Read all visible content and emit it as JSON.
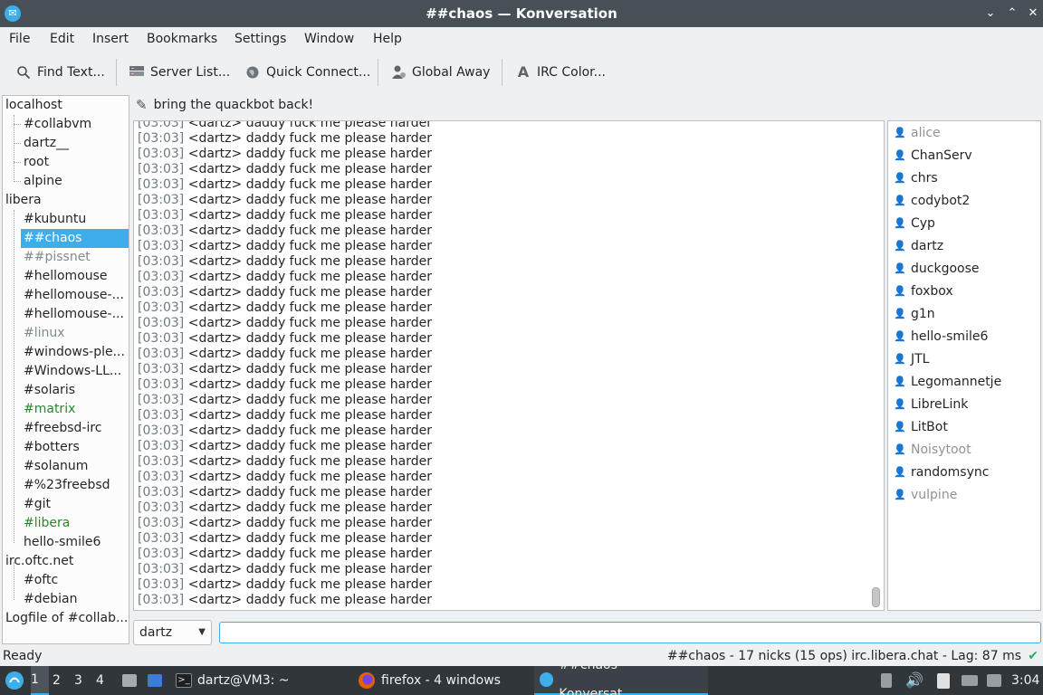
{
  "window": {
    "title": "##chaos — Konversation",
    "minimize_glyph": "⌄",
    "maximize_glyph": "⌃",
    "close_glyph": "✕"
  },
  "menu": [
    "File",
    "Edit",
    "Insert",
    "Bookmarks",
    "Settings",
    "Window",
    "Help"
  ],
  "toolbar": {
    "find_text": "Find Text...",
    "server_list": "Server List...",
    "quick_connect": "Quick Connect...",
    "global_away": "Global Away",
    "irc_color": "IRC Color..."
  },
  "tree": {
    "localhost": "localhost",
    "localhost_children": [
      "#collabvm",
      "dartz__",
      "root",
      "alpine"
    ],
    "libera": "libera",
    "libera_children": [
      "#kubuntu",
      "##chaos",
      "##pissnet",
      "#hellomouse",
      "#hellomouse-...",
      "#hellomouse-...",
      "#linux",
      "#windows-ple...",
      "#Windows-LL...",
      "#solaris",
      "#matrix",
      "#freebsd-irc",
      "#botters",
      "#solanum",
      "#%23freebsd",
      "#git",
      "#libera",
      "hello-smile6"
    ],
    "oftc": "irc.oftc.net",
    "oftc_children": [
      "#oftc",
      "#debian"
    ],
    "logfile": "Logfile of #collab..."
  },
  "topic": "bring the quackbot back!",
  "chat": {
    "timestamp": "[03:03]",
    "message": "<dartz> daddy fuck me please harder",
    "line_count": 32
  },
  "nicks": [
    {
      "name": "alice",
      "away": true
    },
    {
      "name": "ChanServ",
      "away": false
    },
    {
      "name": "chrs",
      "away": false
    },
    {
      "name": "codybot2",
      "away": false
    },
    {
      "name": "Cyp",
      "away": false
    },
    {
      "name": "dartz",
      "away": false
    },
    {
      "name": "duckgoose",
      "away": false
    },
    {
      "name": "foxbox",
      "away": false
    },
    {
      "name": "g1n",
      "away": false
    },
    {
      "name": "hello-smile6",
      "away": false
    },
    {
      "name": "JTL",
      "away": false
    },
    {
      "name": "Legomannetje",
      "away": false
    },
    {
      "name": "LibreLink",
      "away": false
    },
    {
      "name": "LitBot",
      "away": false
    },
    {
      "name": "Noisytoot",
      "away": true
    },
    {
      "name": "randomsync",
      "away": false
    },
    {
      "name": "vulpine",
      "away": true
    }
  ],
  "nick_selector": "dartz",
  "input_value": "",
  "status": {
    "left": "Ready",
    "right": "##chaos - 17 nicks (15 ops)  irc.libera.chat - Lag: 87 ms"
  },
  "taskbar": {
    "workspaces": [
      "1",
      "2",
      "3",
      "4"
    ],
    "terminal": "dartz@VM3: ~",
    "firefox": "firefox - 4 windows",
    "konversation": "##chaos — Konversat...",
    "clock": "3:04"
  },
  "colors": {
    "accent": "#3daee9",
    "titlebar": "#475057",
    "taskbar": "#31363b",
    "green_channel": "#27892c"
  }
}
